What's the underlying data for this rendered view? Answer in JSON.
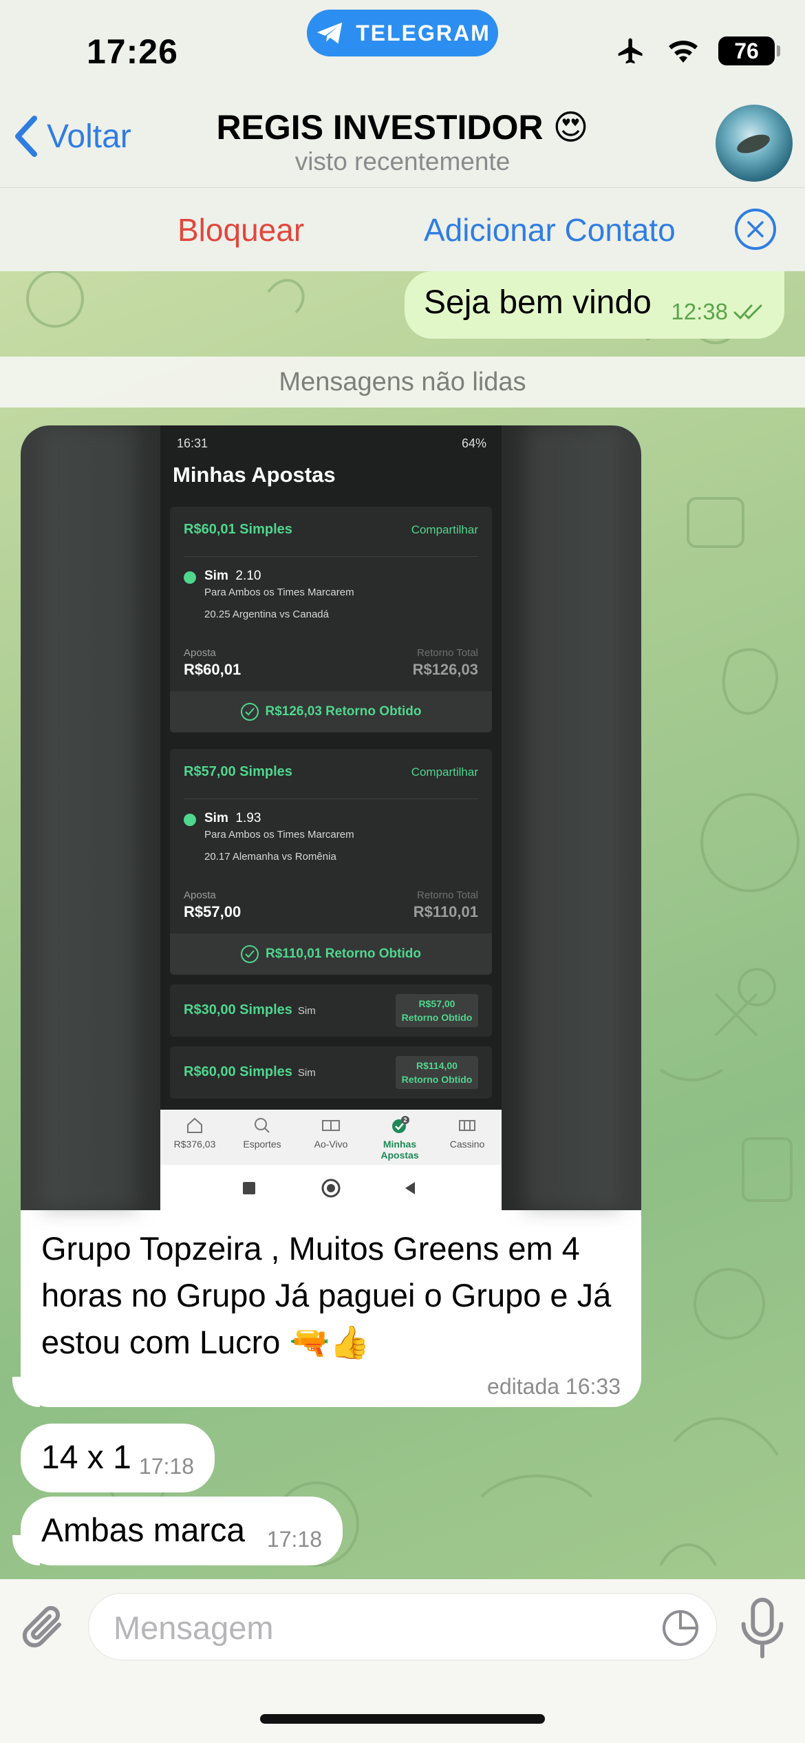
{
  "status_bar": {
    "time": "17:26",
    "telegram_label": "TELEGRAM",
    "battery": "76"
  },
  "header": {
    "back_label": "Voltar",
    "title": "REGIS INVESTIDOR 😍",
    "subtitle": "visto recentemente"
  },
  "actions": {
    "block_label": "Bloquear",
    "add_contact_label": "Adicionar Contato"
  },
  "messages": {
    "outgoing": {
      "text": "Seja bem vindo",
      "time": "12:38"
    },
    "unread_label": "Mensagens não lidas",
    "photo_message": {
      "caption": "Grupo Topzeira , Muitos Greens em 4 horas no Grupo Já paguei o Grupo e Já estou com Lucro 🔫👍",
      "edited": "editada 16:33",
      "screenshot": {
        "status_time": "16:31",
        "status_battery": "64%",
        "title": "Minhas Apostas",
        "share_label": "Compartilhar",
        "bets": [
          {
            "amount_label": "R$60,01 Simples",
            "selection": "Sim",
            "odds": "2.10",
            "market": "Para Ambos os Times Marcarem",
            "event": "20.25 Argentina vs Canadá",
            "stake_label": "Aposta",
            "stake": "R$60,01",
            "return_label": "Retorno Total",
            "return": "R$126,03",
            "result": "R$126,03  Retorno Obtido"
          },
          {
            "amount_label": "R$57,00 Simples",
            "selection": "Sim",
            "odds": "1.93",
            "market": "Para Ambos os Times Marcarem",
            "event": "20.17 Alemanha vs Romênia",
            "stake_label": "Aposta",
            "stake": "R$57,00",
            "return_label": "Retorno Total",
            "return": "R$110,01",
            "result": "R$110,01  Retorno Obtido"
          }
        ],
        "compact_bets": [
          {
            "amount_label": "R$30,00 Simples",
            "selection": "Sim",
            "badge_value": "R$57,00",
            "badge_label": "Retorno Obtido"
          },
          {
            "amount_label": "R$60,00 Simples",
            "selection": "Sim",
            "badge_value": "R$114,00",
            "badge_label": "Retorno Obtido"
          }
        ],
        "tabs": [
          {
            "label": "R$376,03"
          },
          {
            "label": "Esportes"
          },
          {
            "label": "Ao-Vivo"
          },
          {
            "label": "Minhas Apostas",
            "badge": "2"
          },
          {
            "label": "Cassino"
          }
        ]
      }
    },
    "incoming": [
      {
        "text": "14 x 1",
        "time": "17:18"
      },
      {
        "text": "Ambas marca",
        "time": "17:18"
      }
    ]
  },
  "input": {
    "placeholder": "Mensagem"
  },
  "colors": {
    "accent": "#2f7de1",
    "danger": "#e0473d",
    "outgoing_bubble": "#e2f7c8",
    "bet_green": "#4fd78e"
  }
}
